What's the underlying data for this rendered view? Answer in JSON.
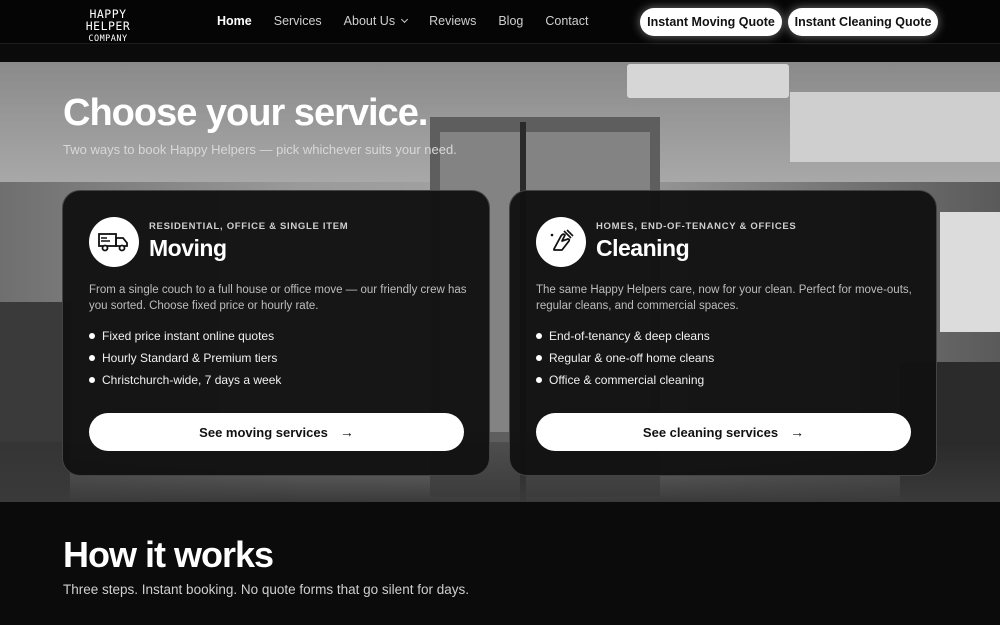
{
  "brand": {
    "line1": "HAPPY HELPER",
    "line2": "COMPANY"
  },
  "nav": {
    "links": [
      {
        "label": "Home",
        "active": true
      },
      {
        "label": "Services"
      },
      {
        "label": "About Us",
        "dropdown": true
      },
      {
        "label": "Reviews"
      },
      {
        "label": "Blog"
      },
      {
        "label": "Contact"
      }
    ],
    "quote_moving_label": "Instant Moving Quote",
    "quote_cleaning_label": "Instant Cleaning Quote"
  },
  "hero": {
    "title": "Choose your service.",
    "subtitle": "Two ways to book Happy Helpers — pick whichever suits your need."
  },
  "cards": [
    {
      "kicker": "RESIDENTIAL, OFFICE & SINGLE ITEM",
      "title": "Moving",
      "icon": "moving-truck-icon",
      "description": "From a single couch to a full house or office move — our friendly crew has you sorted. Choose fixed price or hourly rate.",
      "features": [
        "Fixed price instant online quotes",
        "Hourly Standard & Premium tiers",
        "Christchurch-wide, 7 days a week"
      ],
      "button_label": "See moving services"
    },
    {
      "kicker": "HOMES, END-OF-TENANCY & OFFICES",
      "title": "Cleaning",
      "icon": "cleaning-hand-icon",
      "description": "The same Happy Helpers care, now for your clean. Perfect for move-outs, regular cleans, and commercial spaces.",
      "features": [
        "End-of-tenancy & deep cleans",
        "Regular & one-off home cleans",
        "Office & commercial cleaning"
      ],
      "button_label": "See cleaning services"
    }
  ],
  "how": {
    "title": "How it works",
    "subtitle": "Three steps. Instant booking. No quote forms that go silent for days."
  },
  "colors": {
    "background": "#0b0b0b",
    "card": "#121212",
    "button": "#ffffff"
  }
}
